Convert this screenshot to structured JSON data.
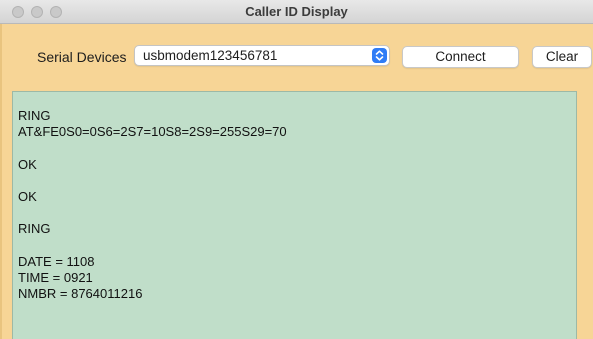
{
  "window": {
    "title": "Caller ID Display"
  },
  "toolbar": {
    "devices_label": "Serial Devices",
    "device_selected": "usbmodem123456781",
    "connect_label": "Connect",
    "clear_label": "Clear"
  },
  "output": {
    "lines": [
      "RING",
      "AT&FE0S0=0S6=2S7=10S8=2S9=255S29=70",
      "",
      "OK",
      "",
      "OK",
      "",
      "RING",
      "",
      "DATE = 1108",
      "TIME = 0921",
      "NMBR = 8764011216"
    ]
  },
  "colors": {
    "window_background": "#f7d596",
    "output_background": "#c0dec9",
    "select_accent": "#2f7cf6"
  },
  "icons": {
    "close": "close-icon",
    "minimize": "minimize-icon",
    "maximize": "maximize-icon",
    "stepper": "chevron-updown-icon"
  }
}
